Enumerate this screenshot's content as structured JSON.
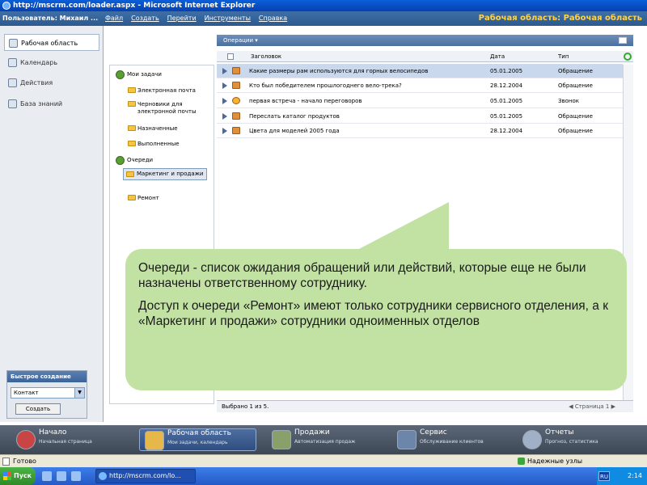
{
  "window": {
    "title": "http://mscrm.com/loader.aspx - Microsoft Internet Explorer"
  },
  "menubar": {
    "user": "Пользователь: Михаил ...",
    "menus": [
      "Файл",
      "Создать",
      "Перейти",
      "Инструменты",
      "Справка"
    ],
    "area_title": "Рабочая область: Рабочая область"
  },
  "leftnav": {
    "items": [
      {
        "label": "Рабочая область",
        "icon": "workspace-icon"
      },
      {
        "label": "Календарь",
        "icon": "calendar-icon"
      },
      {
        "label": "Действия",
        "icon": "actions-icon"
      },
      {
        "label": "База знаний",
        "icon": "knowledge-base-icon"
      }
    ]
  },
  "quick_create": {
    "title": "Быстрое создание",
    "selected": "Контакт",
    "button": "Создать"
  },
  "tree": {
    "my_tasks": "Мои задачи",
    "email": "Электронная почта",
    "drafts": "Черновики для электронной почты",
    "assigned": "Назначенные",
    "completed": "Выполненные",
    "queues": "Очереди",
    "marketing": "Маркетинг и продажи",
    "repair": "Ремонт"
  },
  "panel": {
    "header": "Операции",
    "columns": {
      "subject": "Заголовок",
      "date": "Дата",
      "type": "Тип"
    },
    "rows": [
      {
        "subject": "Какие размеры рам используются для горных велосипедов",
        "date": "05.01.2005",
        "type": "Обращение"
      },
      {
        "subject": "Кто был победителем прошлогоднего вело-трека?",
        "date": "28.12.2004",
        "type": "Обращение"
      },
      {
        "subject": "первая встреча - начало переговоров",
        "date": "05.01.2005",
        "type": "Звонок"
      },
      {
        "subject": "Переслать каталог продуктов",
        "date": "05.01.2005",
        "type": "Обращение"
      },
      {
        "subject": "Цвета для моделей 2005 года",
        "date": "28.12.2004",
        "type": "Обращение"
      }
    ],
    "selected_count": "Выбрано 1 из 5.",
    "pager": "Страница 1"
  },
  "callout": {
    "p1": "Очереди - список ожидания обращений или действий, которые еще не были назначены ответственному сотруднику.",
    "p2": "Доступ к очереди «Ремонт» имеют только сотрудники сервисного отделения, а к «Маркетинг и продажи» сотрудники одноименных отделов"
  },
  "bottom_nav": [
    {
      "title": "Начало",
      "sub": "Начальная страница"
    },
    {
      "title": "Рабочая область",
      "sub": "Мои задачи, календарь"
    },
    {
      "title": "Продажи",
      "sub": "Автоматизация продаж"
    },
    {
      "title": "Сервис",
      "sub": "Обслуживание клиентов"
    },
    {
      "title": "Отчеты",
      "sub": "Прогноз, статистика"
    }
  ],
  "ie_status": {
    "ready": "Готово",
    "zone": "Надежные узлы"
  },
  "taskbar": {
    "start": "Пуск",
    "task": "http://mscrm.com/lo...",
    "lang": "RU",
    "clock": "2:14"
  },
  "colors": {
    "callout_bg": "#c2e2a4",
    "header_blue": "#2d5a8f",
    "area_title": "#ffd34a"
  }
}
